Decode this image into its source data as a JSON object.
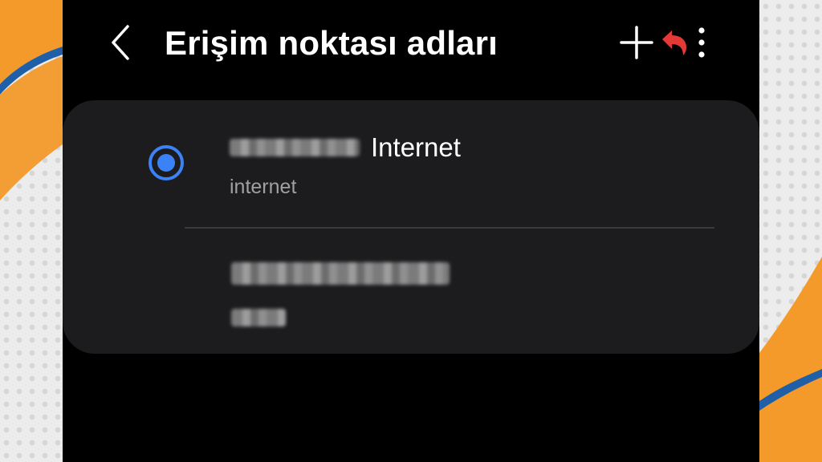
{
  "header": {
    "title": "Erişim noktası adları",
    "back_icon": "chevron-left-icon",
    "add_icon": "plus-icon",
    "undo_icon": "undo-arrow-icon",
    "more_icon": "more-vertical-icon"
  },
  "apn_list": [
    {
      "name": "Internet",
      "subtitle": "internet",
      "selected": true,
      "name_prefix_blurred": true
    },
    {
      "name": "",
      "subtitle": "",
      "selected": false,
      "name_blurred": true,
      "subtitle_blurred": true
    }
  ],
  "colors": {
    "screen_bg": "#000000",
    "card_bg": "#1c1c1e",
    "accent_blue": "#3b82f6",
    "annotation_red": "#e53935",
    "backdrop_orange": "#f39a2b",
    "backdrop_blue": "#1f5fa8"
  }
}
